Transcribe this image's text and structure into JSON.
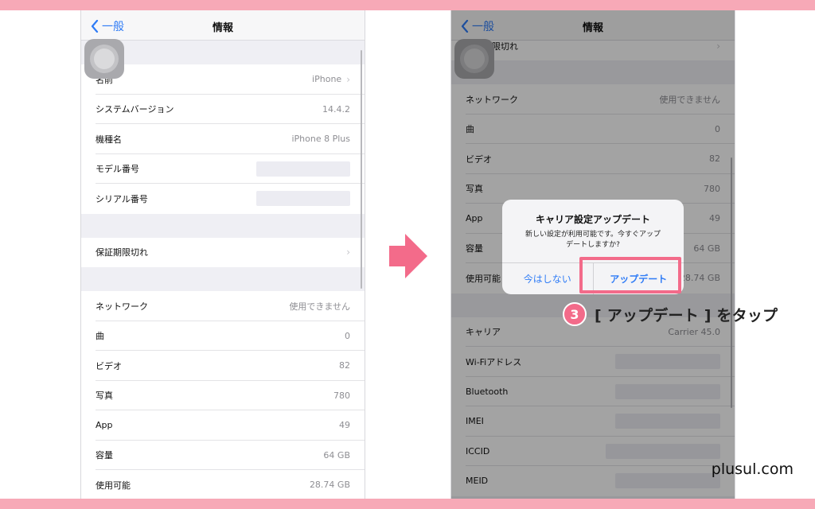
{
  "colors": {
    "band": "#f7a9b7",
    "accent": "#f36b8a",
    "ios_blue": "#2f7cf6"
  },
  "left_screen": {
    "back_label": "一般",
    "title": "情報",
    "rows": [
      {
        "label": "名前",
        "value": "iPhone",
        "chevron": true
      },
      {
        "label": "システムバージョン",
        "value": "14.4.2"
      },
      {
        "label": "機種名",
        "value": "iPhone 8 Plus"
      },
      {
        "label": "モデル番号",
        "value": ""
      },
      {
        "label": "シリアル番号",
        "value": ""
      },
      {
        "label": "保証期限切れ",
        "value": "",
        "chevron": true
      },
      {
        "label": "ネットワーク",
        "value": "使用できません"
      },
      {
        "label": "曲",
        "value": "0"
      },
      {
        "label": "ビデオ",
        "value": "82"
      },
      {
        "label": "写真",
        "value": "780"
      },
      {
        "label": "App",
        "value": "49"
      },
      {
        "label": "容量",
        "value": "64 GB"
      },
      {
        "label": "使用可能",
        "value": "28.74 GB"
      }
    ]
  },
  "right_screen": {
    "back_label": "一般",
    "title": "情報",
    "rows": [
      {
        "label": "保証期限切れ",
        "value": "",
        "chevron": true
      },
      {
        "label": "ネットワーク",
        "value": "使用できません"
      },
      {
        "label": "曲",
        "value": "0"
      },
      {
        "label": "ビデオ",
        "value": "82"
      },
      {
        "label": "写真",
        "value": "780"
      },
      {
        "label": "App",
        "value": "49"
      },
      {
        "label": "容量",
        "value": "64 GB"
      },
      {
        "label": "使用可能",
        "value": "28.74 GB"
      },
      {
        "label": "キャリア",
        "value": "Carrier 45.0"
      },
      {
        "label": "Wi-Fiアドレス",
        "value": ""
      },
      {
        "label": "Bluetooth",
        "value": ""
      },
      {
        "label": "IMEI",
        "value": ""
      },
      {
        "label": "ICCID",
        "value": ""
      },
      {
        "label": "MEID",
        "value": ""
      }
    ],
    "alert": {
      "title": "キャリア設定アップデート",
      "message_line1": "新しい設定が利用可能です。今すぐアップ",
      "message_line2": "デートしますか?",
      "cancel_label": "今はしない",
      "confirm_label": "アップデート"
    }
  },
  "annotation": {
    "step_number": "3",
    "text": "[ アップデート ] をタップ"
  },
  "watermark": "plusul.com"
}
